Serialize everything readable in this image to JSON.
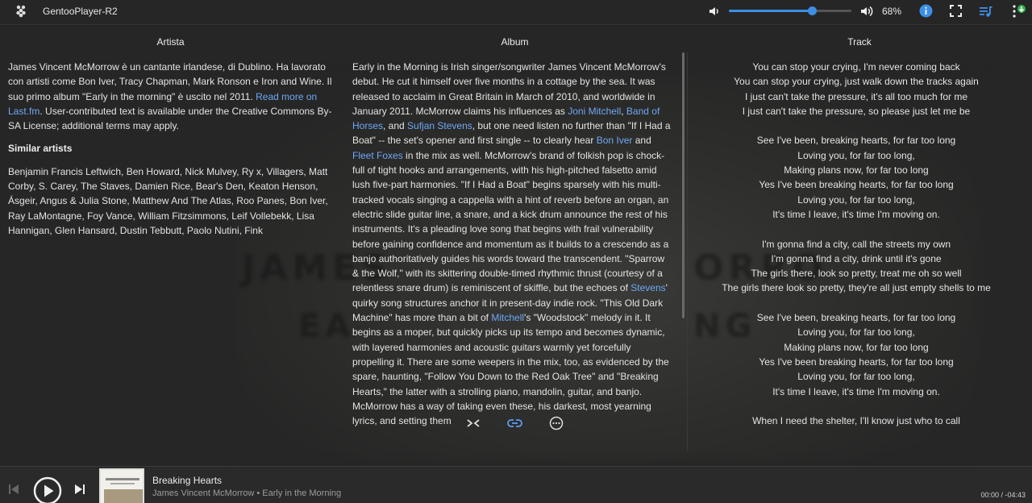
{
  "app": {
    "title": "GentooPlayer-R2",
    "icons": {
      "logo": "raspberry-icon",
      "volume_down": "volume-down-icon",
      "volume_up": "volume-up-icon",
      "info": "info-icon",
      "fullscreen": "fullscreen-icon",
      "queue": "queue-music-icon",
      "menu": "settings-menu-icon"
    },
    "accent": "#3d8fe6",
    "link_color": "#6ea8f5"
  },
  "volume": {
    "level": 0.68,
    "label": "68%"
  },
  "columns": {
    "artist": {
      "header": "Artista",
      "bio_text": "James Vincent McMorrow è un cantante irlandese, di Dublino. Ha lavorato con artisti come Bon Iver, Tracy Chapman, Mark Ronson e Iron and Wine. Il suo primo album \"Early in the morning\" è uscito nel 2011. ",
      "read_more": "Read more on Last.fm",
      "bio_tail": ". User-contributed text is available under the Creative Commons By-SA License; additional terms may apply.",
      "similar_header": "Similar artists",
      "similar_list": "Benjamin Francis Leftwich, Ben Howard, Nick Mulvey, Ry x, Villagers, Matt Corby, S. Carey, The Staves, Damien Rice, Bear's Den, Keaton Henson, Ásgeir, Angus & Julia Stone, Matthew And The Atlas, Roo Panes, Bon Iver, Ray LaMontagne, Foy Vance, William Fitzsimmons, Leif Vollebekk, Lisa Hannigan, Glen Hansard, Dustin Tebbutt, Paolo Nutini, Fink"
    },
    "album": {
      "header": "Album",
      "segments": [
        {
          "t": "Early in the Morning is Irish singer/songwriter James Vincent McMorrow's debut. He cut it himself over five months in a cottage by the sea. It was released to acclaim in Great Britain in March of 2010, and worldwide in January 2011. McMorrow claims his influences as "
        },
        {
          "t": "Joni Mitchell",
          "link": true
        },
        {
          "t": ", "
        },
        {
          "t": "Band of Horses",
          "link": true
        },
        {
          "t": ", and "
        },
        {
          "t": "Sufjan Stevens",
          "link": true
        },
        {
          "t": ", but one need listen no further than \"If I Had a Boat\" -- the set's opener and first single -- to clearly hear "
        },
        {
          "t": "Bon Iver",
          "link": true
        },
        {
          "t": " and "
        },
        {
          "t": "Fleet Foxes",
          "link": true
        },
        {
          "t": " in the mix as well. McMorrow's brand of folkish pop is chock-full of tight hooks and arrangements, with his high-pitched falsetto amid lush five-part harmonies. \"If I Had a Boat\" begins sparsely with his multi-tracked vocals singing a cappella with a hint of reverb before an organ, an electric slide guitar line, a snare, and a kick drum announce the rest of his instruments. It's a pleading love song that begins with frail vulnerability before gaining confidence and momentum as it builds to a crescendo as a banjo authoritatively guides his words toward the transcendent. \"Sparrow & the Wolf,\" with its skittering double-timed rhythmic thrust (courtesy of a relentless snare drum) is reminiscent of skiffle, but the echoes of "
        },
        {
          "t": "Stevens",
          "link": true
        },
        {
          "t": "' quirky song structures anchor it in present-day indie rock. \"This Old Dark Machine\" has more than a bit of "
        },
        {
          "t": "Mitchell",
          "link": true
        },
        {
          "t": "'s \"Woodstock\" melody in it. It begins as a moper, but quickly picks up its tempo and becomes dynamic, with layered harmonies and acoustic guitars warmly yet forcefully propelling it. There are some weepers in the mix, too, as evidenced by the spare, haunting, \"Follow You Down to the Red Oak Tree\" and \"Breaking Hearts,\" the latter with a strolling piano, mandolin, guitar, and banjo. McMorrow has a way of taking even these, his darkest, most yearning lyrics, and setting them"
        }
      ]
    },
    "track": {
      "header": "Track",
      "lyrics": [
        "You can stop your crying, I'm never coming back",
        "You can stop your crying, just walk down the tracks again",
        "I just can't take the pressure, it's all too much for me",
        "I just can't take the pressure, so please just let me be",
        "",
        "See I've been, breaking hearts, for far too long",
        "Loving you, for far too long,",
        "Making plans now, for far too long",
        "Yes I've been breaking hearts, for far too long",
        "Loving you, for far too long,",
        "It's time I leave, it's time I'm moving on.",
        "",
        "I'm gonna find a city, call the streets my own",
        "I'm gonna find a city, drink until it's gone",
        "The girls there, look so pretty, treat me oh so well",
        "The girls there look so pretty, they're all just empty shells to me",
        "",
        "See I've been, breaking hearts, for far too long",
        "Loving you, for far too long,",
        "Making plans now, for far too long",
        "Yes I've been breaking hearts, for far too long",
        "Loving you, for far too long,",
        "It's time I leave, it's time I'm moving on.",
        "",
        "When I need the shelter, I'll know just who to call"
      ]
    }
  },
  "bottom_actions": {
    "collapse": "collapse-icon",
    "link": "link-icon",
    "more": "more-horizontal-icon"
  },
  "player": {
    "title": "Breaking Hearts",
    "subtitle": "James Vincent McMorrow • Early in the Morning",
    "time": "00:00 / -04:43",
    "icons": {
      "prev": "skip-previous-icon",
      "play": "play-circle-icon",
      "next": "skip-next-icon"
    }
  }
}
